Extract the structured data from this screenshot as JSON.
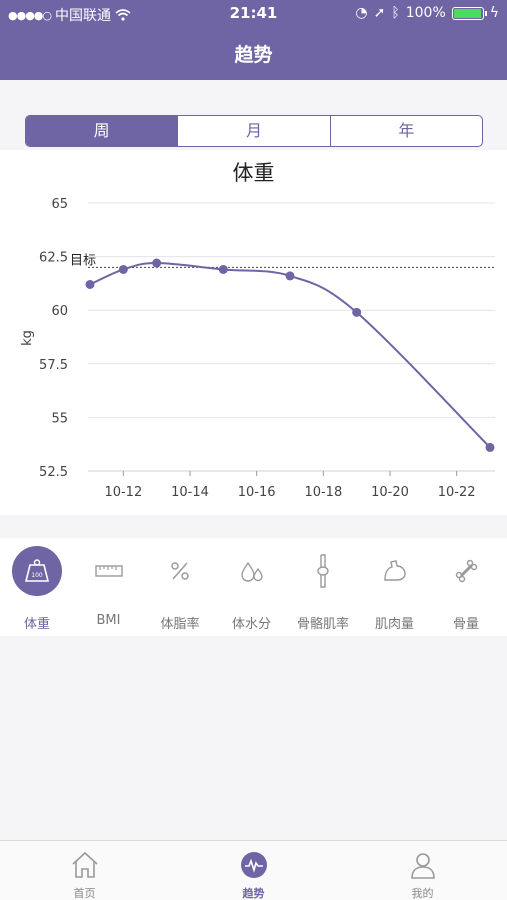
{
  "status": {
    "carrier": "中国联通",
    "time": "21:41",
    "battery": "100%",
    "battery_level": 1.0
  },
  "header": {
    "title": "趋势"
  },
  "segments": [
    {
      "label": "周",
      "active": true
    },
    {
      "label": "月",
      "active": false
    },
    {
      "label": "年",
      "active": false
    }
  ],
  "colors": {
    "accent": "#6f64a4",
    "grid": "#e3e3ee",
    "target": "#444444"
  },
  "chart_data": {
    "type": "line",
    "title": "体重",
    "ylabel": "kg",
    "xlabel": "",
    "ylim": [
      52.5,
      65
    ],
    "yticks": [
      "65",
      "62.5",
      "60",
      "57.5",
      "55",
      "52.5"
    ],
    "xticks": [
      "10-12",
      "10-14",
      "10-16",
      "10-18",
      "10-20",
      "10-22"
    ],
    "x": [
      "10-11",
      "10-12",
      "10-13",
      "10-15",
      "10-17",
      "10-19",
      "10-23"
    ],
    "series": [
      {
        "values": [
          61.2,
          61.9,
          62.2,
          61.9,
          61.6,
          59.9,
          53.6
        ]
      }
    ],
    "target": {
      "label": "目标",
      "value": 62.0
    },
    "grid": true
  },
  "metrics": [
    {
      "label": "体重",
      "icon": "scale-icon",
      "active": true
    },
    {
      "label": "BMI",
      "icon": "ruler-icon",
      "active": false
    },
    {
      "label": "体脂率",
      "icon": "percent-icon",
      "active": false
    },
    {
      "label": "体水分",
      "icon": "water-drops-icon",
      "active": false
    },
    {
      "label": "骨骼肌率",
      "icon": "bone-joint-icon",
      "active": false
    },
    {
      "label": "肌肉量",
      "icon": "muscle-arm-icon",
      "active": false
    },
    {
      "label": "骨量",
      "icon": "bone-icon",
      "active": false
    }
  ],
  "tabs": [
    {
      "label": "首页",
      "icon": "home-icon",
      "active": false
    },
    {
      "label": "趋势",
      "icon": "trend-icon",
      "active": true
    },
    {
      "label": "我的",
      "icon": "user-icon",
      "active": false
    }
  ]
}
